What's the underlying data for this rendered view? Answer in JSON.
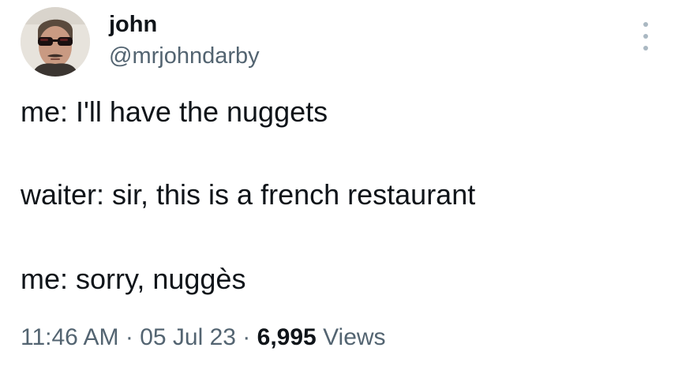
{
  "author": {
    "display_name": "john",
    "handle": "@mrjohndarby"
  },
  "tweet": {
    "lines": [
      "me: I'll have the nuggets",
      "waiter: sir, this is a french restaurant",
      "me: sorry, nuggès"
    ]
  },
  "meta": {
    "time": "11:46 AM",
    "separator": " · ",
    "date": "05 Jul 23",
    "views_count": "6,995",
    "views_label": "Views"
  },
  "icons": {
    "more": "more-options-icon",
    "avatar": "avatar"
  },
  "colors": {
    "text_primary": "#0f1419",
    "text_secondary": "#536471",
    "more_icon": "#aab8c2",
    "background": "#ffffff"
  }
}
